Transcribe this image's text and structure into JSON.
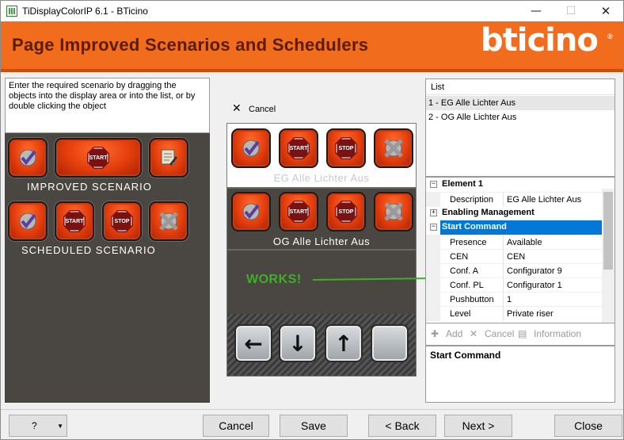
{
  "window": {
    "title": "TiDisplayColorIP 6.1 - BTicino",
    "min": "—",
    "max": "☐",
    "close": "✕"
  },
  "header": {
    "title": "Page Improved Scenarios and Schedulers",
    "logo": "bticino",
    "logo_mark": "®"
  },
  "left": {
    "instructions": "Enter the required scenario by dragging the objects into the display area or into the list, or by double clicking the object",
    "improved_label": "IMPROVED  SCENARIO",
    "scheduled_label": "SCHEDULED  SCENARIO",
    "start": "START",
    "stop": "STOP"
  },
  "middle": {
    "cancel_label": "Cancel",
    "row1_label": "EG Alle Lichter Aus",
    "row2_label": "OG Alle Lichter Aus",
    "annotation": "WORKS!",
    "start": "START",
    "stop": "STOP",
    "nav": {
      "left": "←",
      "down": "↓",
      "up": "↑"
    }
  },
  "list": {
    "header": "List",
    "items": [
      "1 - EG Alle Lichter Aus",
      "2 - OG Alle Lichter Aus"
    ]
  },
  "properties": {
    "element_cat": "Element 1",
    "description_k": "Description",
    "description_v": "EG Alle Lichter Aus",
    "enabling_cat": "Enabling Management",
    "start_cat": "Start Command",
    "rows": [
      {
        "k": "Presence",
        "v": "Available"
      },
      {
        "k": "CEN",
        "v": "CEN"
      },
      {
        "k": "Conf. A",
        "v": "Configurator 9"
      },
      {
        "k": "Conf. PL",
        "v": "Configurator 1"
      },
      {
        "k": "Pushbutton",
        "v": "1"
      },
      {
        "k": "Level",
        "v": "Private riser"
      }
    ],
    "tools": {
      "add": "Add",
      "cancel": "Cancel",
      "information": "Information"
    },
    "description_panel": "Start Command"
  },
  "footer": {
    "help": "?",
    "cancel": "Cancel",
    "save": "Save",
    "back": "< Back",
    "next": "Next >",
    "close": "Close"
  },
  "colors": {
    "header": "#f26c1d",
    "tile": "#e33d0c",
    "panel": "#4a4641",
    "works": "#3fae2a",
    "selection": "#0078d7"
  }
}
